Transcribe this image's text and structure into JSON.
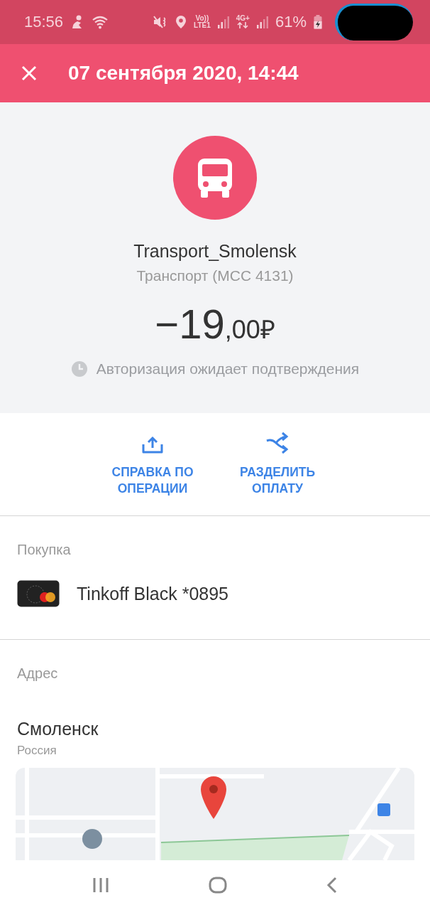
{
  "status_bar": {
    "time": "15:56",
    "network_labels": [
      "Vo))",
      "LTE1",
      "4G+"
    ],
    "battery": "61%"
  },
  "header": {
    "title": "07 сентября 2020, 14:44"
  },
  "summary": {
    "merchant": "Transport_Smolensk",
    "category": "Транспорт (MCC 4131)",
    "amount": {
      "integer": "−19",
      "fraction": ",00",
      "currency": "₽"
    },
    "status": "Авторизация ожидает подтверждения"
  },
  "actions": [
    {
      "kind": "receipt",
      "label": "СПРАВКА ПО ОПЕРАЦИИ"
    },
    {
      "kind": "split",
      "label": "РАЗДЕЛИТЬ ОПЛАТУ"
    }
  ],
  "purchase": {
    "heading": "Покупка",
    "card": "Tinkoff Black *0895"
  },
  "address": {
    "heading": "Адрес",
    "city": "Смоленск",
    "country": "Россия"
  }
}
